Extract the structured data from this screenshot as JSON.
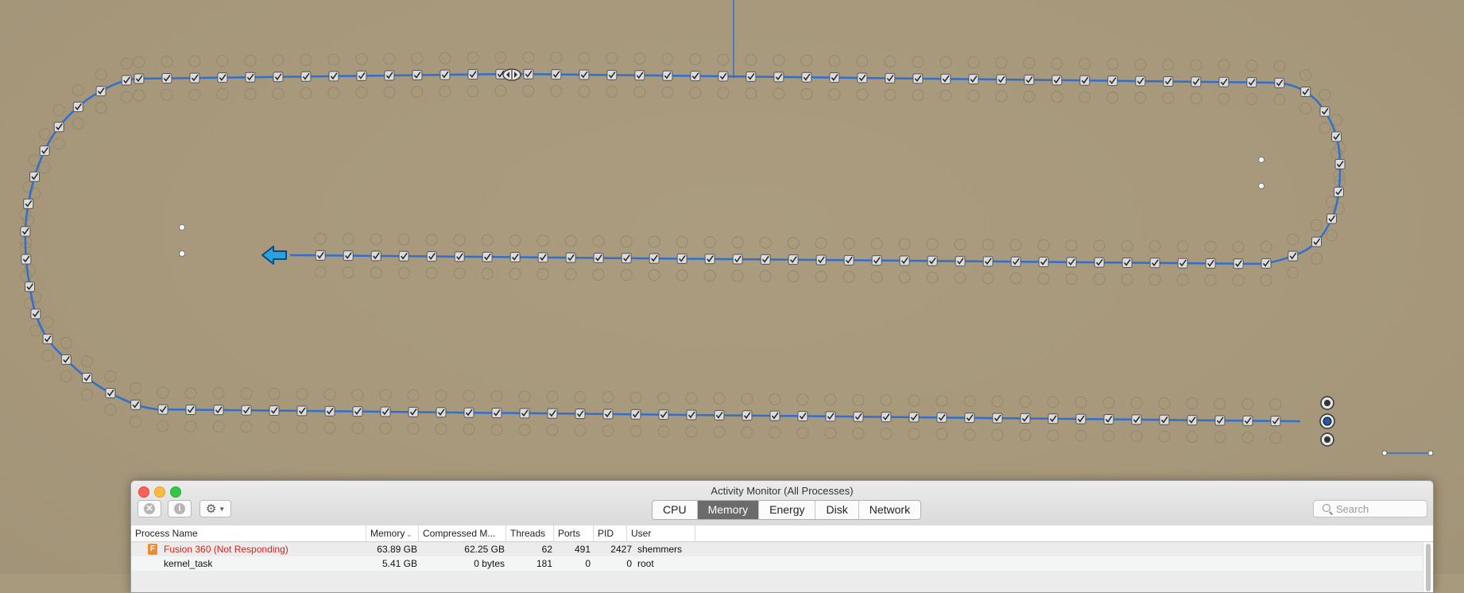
{
  "window": {
    "title": "Activity Monitor (All Processes)"
  },
  "toolbar": {
    "stop_glyph": "✕",
    "info_glyph": "i",
    "gear_glyph": "⚙",
    "tabs": [
      {
        "label": "CPU",
        "active": false
      },
      {
        "label": "Memory",
        "active": true
      },
      {
        "label": "Energy",
        "active": false
      },
      {
        "label": "Disk",
        "active": false
      },
      {
        "label": "Network",
        "active": false
      }
    ],
    "search_placeholder": "Search"
  },
  "table": {
    "columns": [
      "Process Name",
      "Memory",
      "Compressed M...",
      "Threads",
      "Ports",
      "PID",
      "User"
    ],
    "sort_column": "Memory",
    "rows": [
      {
        "name": "Fusion 360 (Not Responding)",
        "memory": "63.89 GB",
        "compressed": "62.25 GB",
        "threads": "62",
        "ports": "491",
        "pid": "2427",
        "user": "shemmers",
        "not_responding": true,
        "icon": "fusion-360-icon"
      },
      {
        "name": "kernel_task",
        "memory": "5.41 GB",
        "compressed": "0 bytes",
        "threads": "181",
        "ports": "0",
        "pid": "0",
        "user": "root",
        "not_responding": false,
        "icon": ""
      }
    ]
  },
  "colors": {
    "canvas_background": "#a89a7d",
    "path_line": "#2f6fd0",
    "not_responding_text": "#e0201b",
    "tab_active": "#6b6b6b"
  }
}
